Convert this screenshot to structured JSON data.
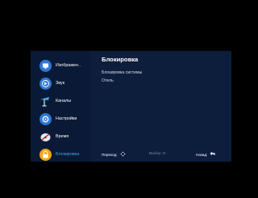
{
  "menu": {
    "items": [
      {
        "label": "Изображен..",
        "icon": "picture-icon",
        "color": "#2f78d6"
      },
      {
        "label": "Звук",
        "icon": "sound-icon",
        "color": "#2f78d6"
      },
      {
        "label": "Каналы",
        "icon": "antenna-icon",
        "color": "#2f78d6"
      },
      {
        "label": "Настройки",
        "icon": "settings-icon",
        "color": "#2f78d6"
      },
      {
        "label": "Время",
        "icon": "clock-icon",
        "color": "#2f78d6"
      },
      {
        "label": "Блокировка",
        "icon": "lock-icon",
        "color": "#f2a516",
        "active": true
      }
    ]
  },
  "panel": {
    "title": "Блокировка",
    "options": [
      "Блокировка системы",
      "Отель"
    ]
  },
  "footer": {
    "navigate_label": "Переход:",
    "select_label": "Выбор: О",
    "back_label": "Назад:"
  },
  "colors": {
    "background": "#000000",
    "menu_bg": "#0d1e3c",
    "accent": "#3fa7e8"
  }
}
